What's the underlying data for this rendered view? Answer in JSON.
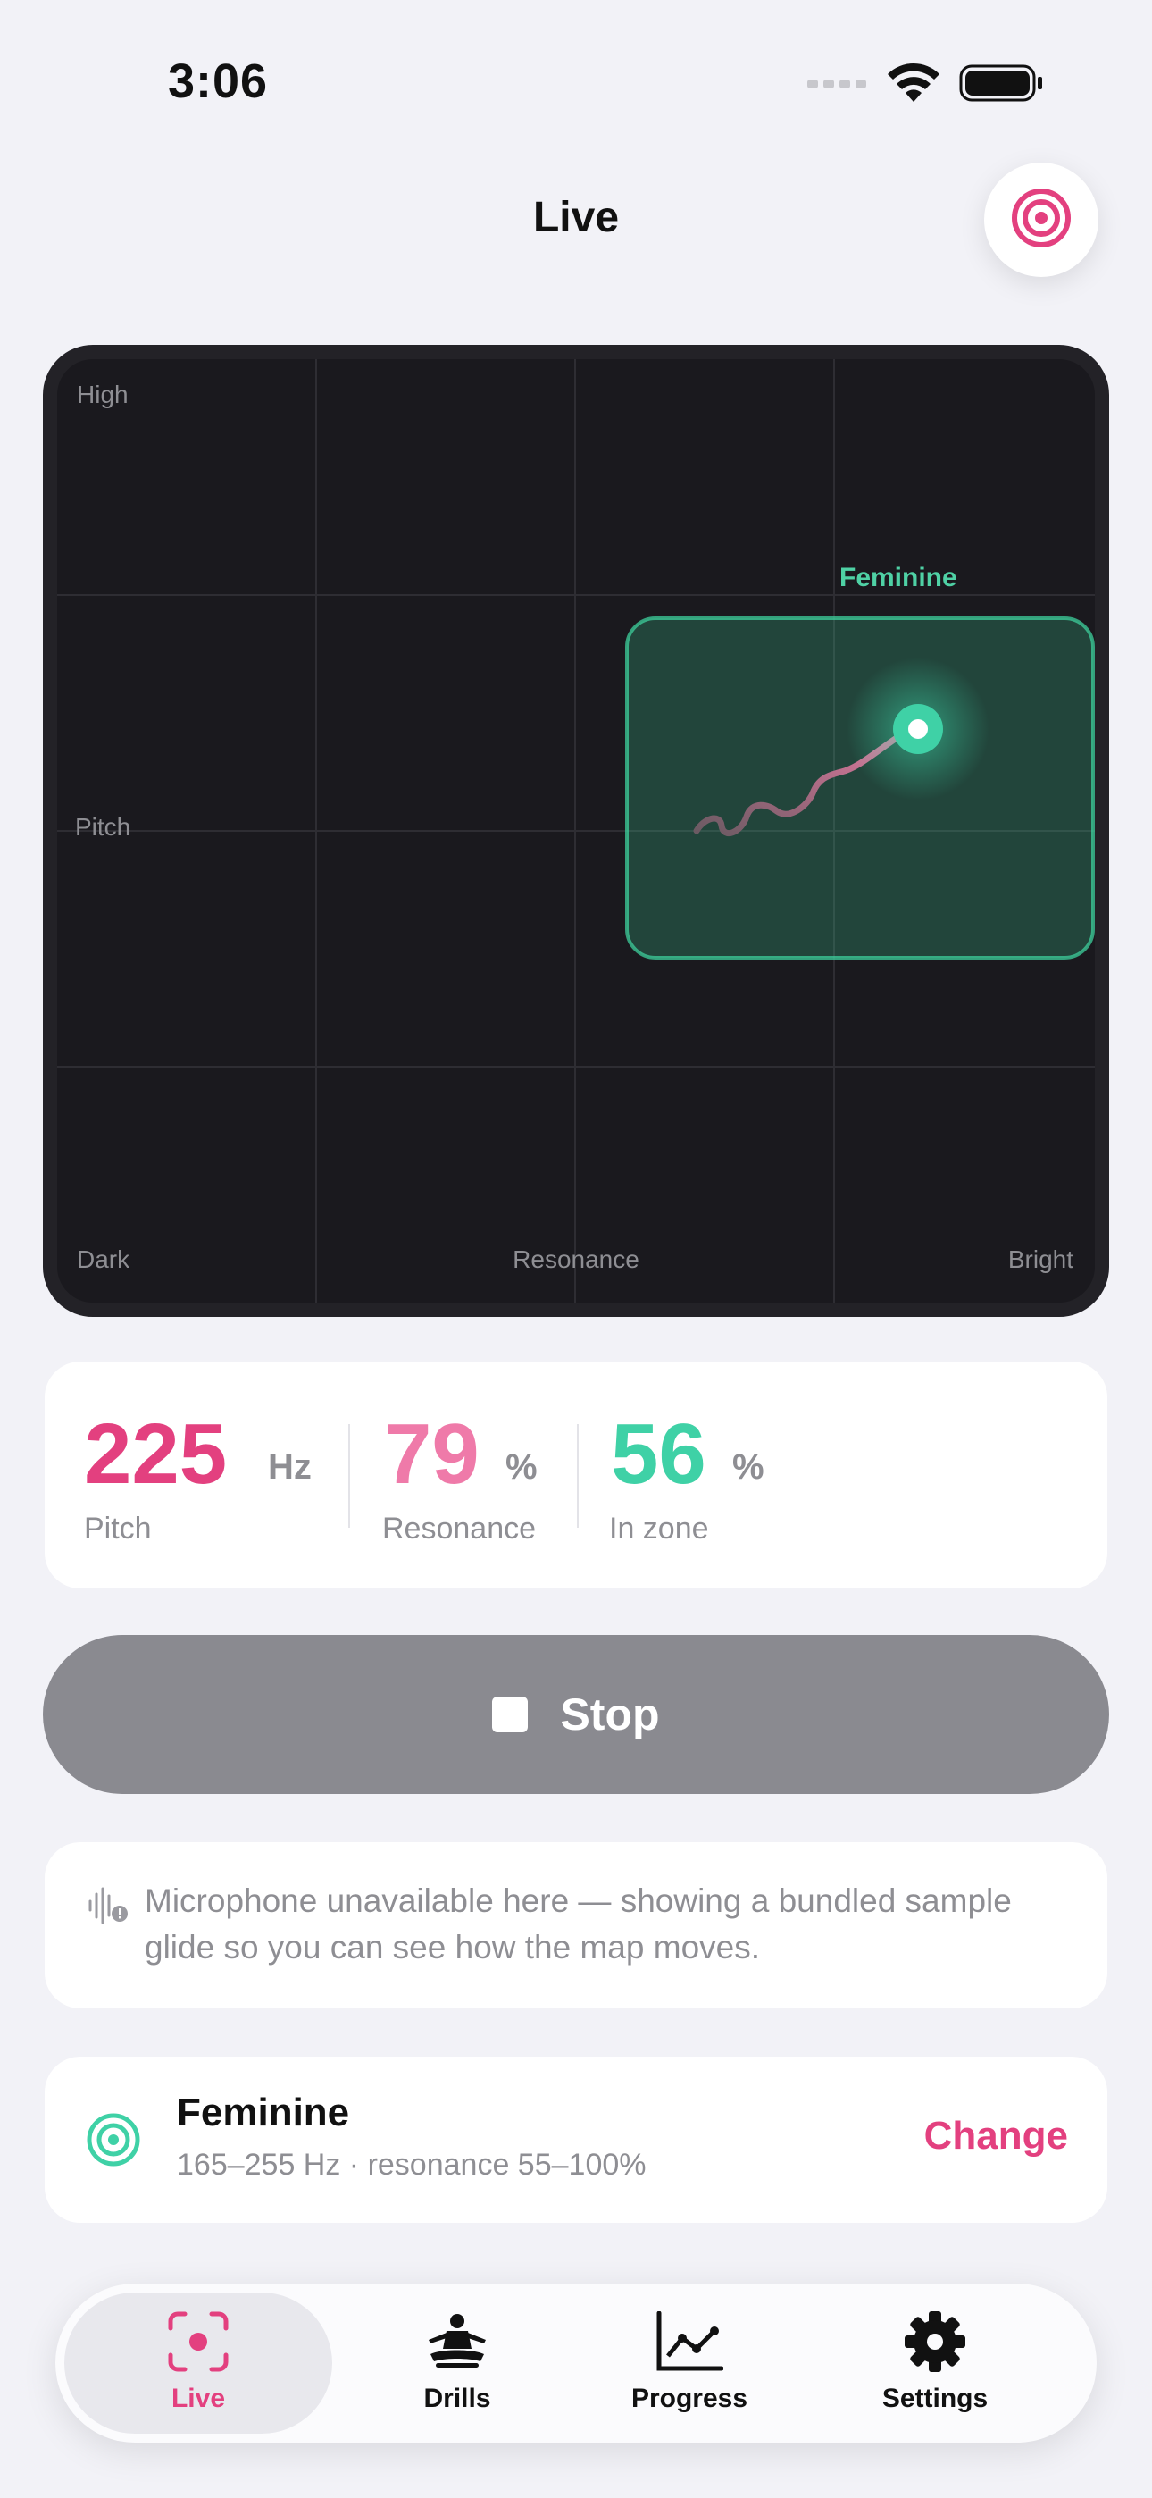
{
  "status_bar": {
    "time": "3:06"
  },
  "header": {
    "title": "Live"
  },
  "map": {
    "label_high": "High",
    "label_pitch": "Pitch",
    "label_dark": "Dark",
    "label_resonance": "Resonance",
    "label_bright": "Bright",
    "zone_label": "Feminine",
    "zone_color": "#4fd1a5"
  },
  "stats": {
    "pitch_value": "225",
    "pitch_unit": "Hz",
    "pitch_label": "Pitch",
    "resonance_value": "79",
    "resonance_unit": "%",
    "resonance_label": "Resonance",
    "inzone_value": "56",
    "inzone_unit": "%",
    "inzone_label": "In zone"
  },
  "stop_button": {
    "label": "Stop"
  },
  "notice": {
    "text": "Microphone unavailable here — showing a bundled sample glide so you can see how the map moves."
  },
  "preset": {
    "name": "Feminine",
    "detail": "165–255 Hz · resonance 55–100%",
    "change_label": "Change"
  },
  "tabs": [
    {
      "label": "Live",
      "icon": "live-icon",
      "active": true
    },
    {
      "label": "Drills",
      "icon": "meditation-icon",
      "active": false
    },
    {
      "label": "Progress",
      "icon": "chart-icon",
      "active": false
    },
    {
      "label": "Settings",
      "icon": "gear-icon",
      "active": false
    }
  ],
  "colors": {
    "accent": "#e3407f",
    "resonance": "#ef7aa9",
    "zone": "#3fd1a6",
    "stop": "#8a8a90"
  }
}
